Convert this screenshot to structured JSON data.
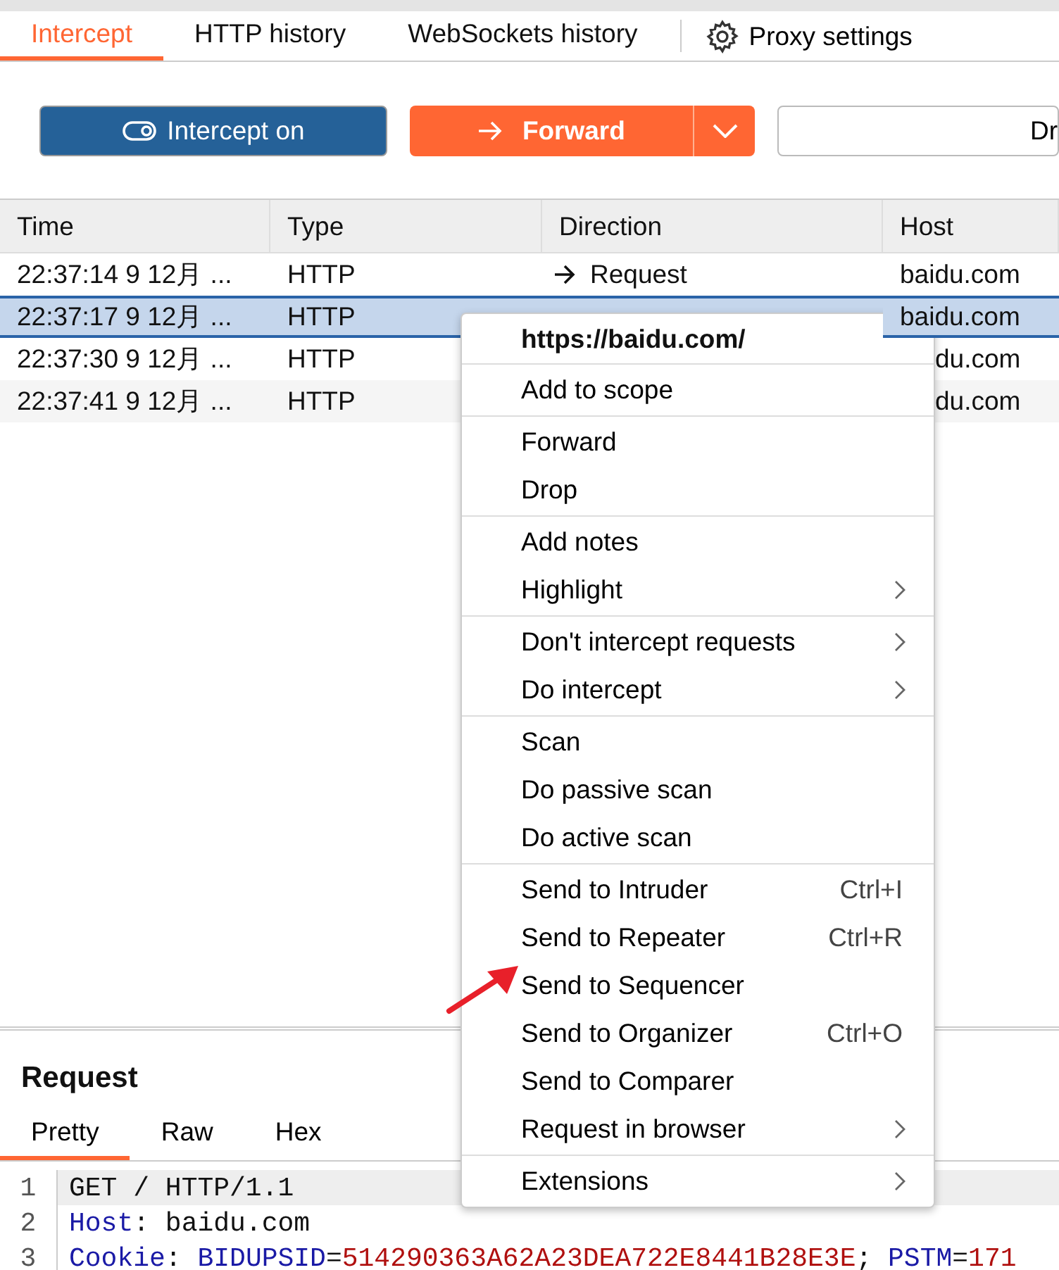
{
  "tabs": [
    {
      "label": "Intercept",
      "selected": true
    },
    {
      "label": "HTTP history",
      "selected": false
    },
    {
      "label": "WebSockets history",
      "selected": false
    }
  ],
  "settings_tab": {
    "label": "Proxy settings"
  },
  "toolbar": {
    "intercept": {
      "label": "Intercept on",
      "on": true
    },
    "forward": {
      "label": "Forward"
    },
    "drop": {
      "label": "Dr"
    }
  },
  "table": {
    "columns": [
      "Time",
      "Type",
      "Direction",
      "Host"
    ],
    "rows": [
      {
        "time": "22:37:14 9 12月 ...",
        "type": "HTTP",
        "direction": "Request",
        "host": "baidu.com",
        "selected": false
      },
      {
        "time": "22:37:17 9 12月 ...",
        "type": "HTTP",
        "direction": "",
        "host": "baidu.com",
        "selected": true
      },
      {
        "time": "22:37:30 9 12月 ...",
        "type": "HTTP",
        "direction": "",
        "host": "du.com",
        "selected": false
      },
      {
        "time": "22:37:41 9 12月 ...",
        "type": "HTTP",
        "direction": "",
        "host": "du.com",
        "selected": false
      }
    ]
  },
  "context_menu": {
    "title": "https://baidu.com/",
    "groups": [
      [
        {
          "label": "Add to scope",
          "submenu": false
        }
      ],
      [
        {
          "label": "Forward",
          "submenu": false
        },
        {
          "label": "Drop",
          "submenu": false
        }
      ],
      [
        {
          "label": "Add notes",
          "submenu": false
        },
        {
          "label": "Highlight",
          "submenu": true
        }
      ],
      [
        {
          "label": "Don't intercept requests",
          "submenu": true
        },
        {
          "label": "Do intercept",
          "submenu": true
        }
      ],
      [
        {
          "label": "Scan",
          "submenu": false
        },
        {
          "label": "Do passive scan",
          "submenu": false
        },
        {
          "label": "Do active scan",
          "submenu": false
        }
      ],
      [
        {
          "label": "Send to Intruder",
          "shortcut": "Ctrl+I",
          "submenu": false
        },
        {
          "label": "Send to Repeater",
          "shortcut": "Ctrl+R",
          "submenu": false
        },
        {
          "label": "Send to Sequencer",
          "submenu": false
        },
        {
          "label": "Send to Organizer",
          "shortcut": "Ctrl+O",
          "submenu": false
        },
        {
          "label": "Send to Comparer",
          "submenu": false
        },
        {
          "label": "Request in browser",
          "submenu": true
        }
      ],
      [
        {
          "label": "Extensions",
          "submenu": true
        }
      ]
    ]
  },
  "request": {
    "title": "Request",
    "tabs": [
      {
        "label": "Pretty",
        "selected": true
      },
      {
        "label": "Raw",
        "selected": false
      },
      {
        "label": "Hex",
        "selected": false
      }
    ],
    "lines": [
      {
        "number": "1",
        "current": true,
        "tokens": [
          {
            "text": "GET / HTTP/1.1",
            "kind": "plain"
          }
        ]
      },
      {
        "number": "2",
        "current": false,
        "tokens": [
          {
            "text": "Host",
            "kind": "key"
          },
          {
            "text": ": baidu.com",
            "kind": "plain"
          }
        ]
      },
      {
        "number": "3",
        "current": false,
        "tokens": [
          {
            "text": "Cookie",
            "kind": "key"
          },
          {
            "text": ": ",
            "kind": "plain"
          },
          {
            "text": "BIDUPSID",
            "kind": "key"
          },
          {
            "text": "=",
            "kind": "plain"
          },
          {
            "text": "514290363A62A23DEA722E8441B28E3E",
            "kind": "value"
          },
          {
            "text": "; ",
            "kind": "plain"
          },
          {
            "text": "PSTM",
            "kind": "key"
          },
          {
            "text": "=",
            "kind": "plain"
          },
          {
            "text": "171",
            "kind": "value"
          }
        ]
      }
    ]
  }
}
